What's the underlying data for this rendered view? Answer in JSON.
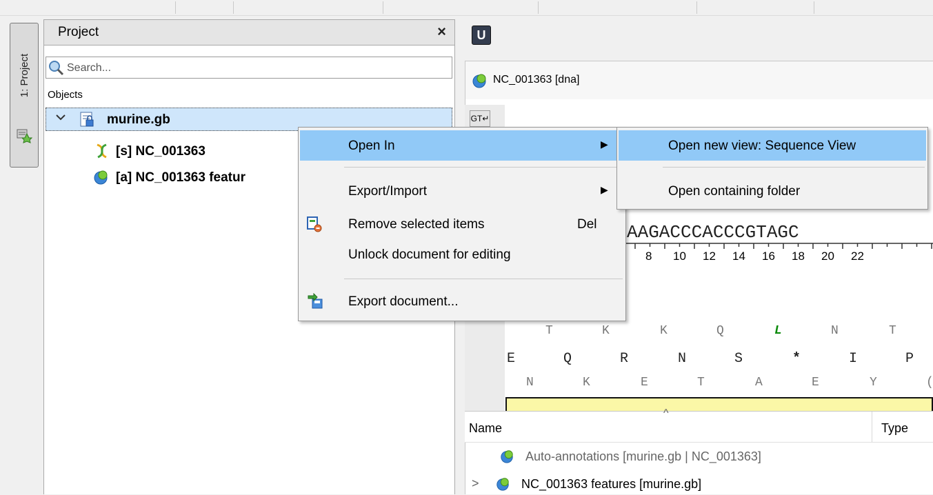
{
  "side_tab": {
    "label": "1: Project"
  },
  "project_panel": {
    "title": "Project",
    "close_symbol": "×",
    "search_placeholder": "Search...",
    "objects_label": "Objects",
    "tree": {
      "root": "murine.gb",
      "children": [
        "[s] NC_001363",
        "[a] NC_001363 featur"
      ]
    }
  },
  "document": {
    "toolbar_button": "U",
    "title": "NC_001363 [dna]",
    "wrap_button": "GT↵",
    "sequence": "AAGACCCACCCGTAGC",
    "ruler": [
      "8",
      "10",
      "12",
      "14",
      "16",
      "18",
      "20",
      "22"
    ],
    "frames": [
      [
        "T",
        "K",
        "K",
        "Q",
        "L",
        "N",
        "T"
      ],
      [
        "E",
        "Q",
        "R",
        "N",
        "S",
        "*",
        "I",
        "P"
      ],
      [
        "N",
        "K",
        "E",
        "T",
        "A",
        "E",
        "Y",
        "("
      ]
    ]
  },
  "annotations": {
    "columns": [
      "Name",
      "Type"
    ],
    "sort_indicator": "^",
    "rows": [
      {
        "label": "Auto-annotations [murine.gb | NC_001363]"
      },
      {
        "expander": ">",
        "label": "NC_001363 features [murine.gb]"
      }
    ]
  },
  "context_menu": {
    "items": [
      {
        "label": "Open In",
        "submenu_arrow": "▶",
        "highlighted": true
      },
      {
        "label": "Export/Import",
        "submenu_arrow": "▶"
      },
      {
        "label": "Remove selected items",
        "shortcut": "Del",
        "icon": "remove-items-icon"
      },
      {
        "label": "Unlock document for editing"
      },
      {
        "label": "Export document...",
        "icon": "export-document-icon"
      }
    ]
  },
  "submenu": {
    "items": [
      {
        "label": "Open new view: Sequence View",
        "highlighted": true
      },
      {
        "label": "Open containing folder"
      }
    ]
  },
  "colors": {
    "menu_highlight": "#91c9f7",
    "selection": "#cfe6fb",
    "highlight_bar": "#fbf7a7",
    "frame_green": "#0a8a0a"
  }
}
